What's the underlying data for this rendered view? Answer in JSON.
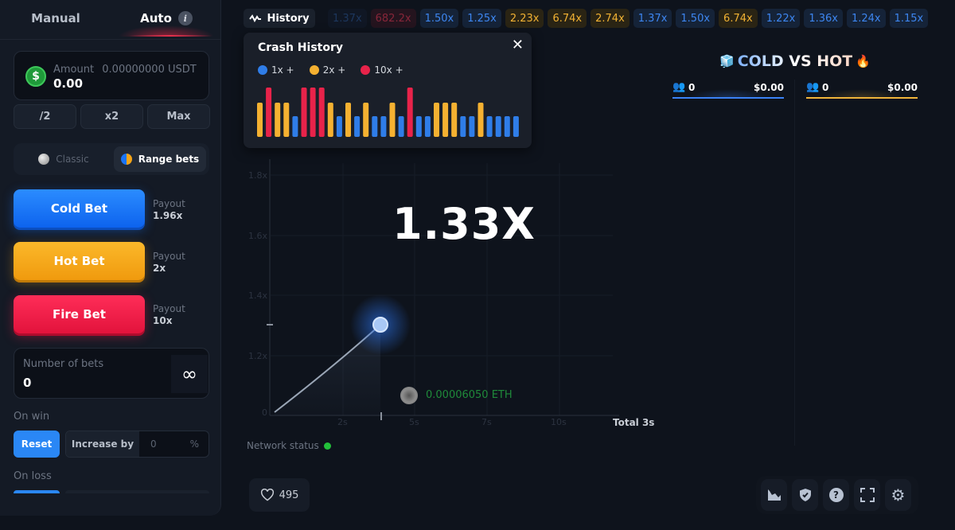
{
  "sidebar": {
    "tabs": [
      {
        "label": "Manual",
        "active": false
      },
      {
        "label": "Auto",
        "active": true
      }
    ],
    "info_icon": "info-icon",
    "amount": {
      "label": "Amount",
      "balance": "0.00000000 USDT",
      "value": "0.00",
      "icon": "dollar-coin-icon"
    },
    "amount_buttons": [
      "/2",
      "x2",
      "Max"
    ],
    "modes": [
      {
        "label": "Classic",
        "active": false
      },
      {
        "label": "Range bets",
        "active": true
      }
    ],
    "bets": [
      {
        "label": "Cold Bet",
        "payout_label": "Payout",
        "payout": "1.96x",
        "color": "#1a73f5"
      },
      {
        "label": "Hot Bet",
        "payout_label": "Payout",
        "payout": "2x",
        "color": "#f5a417"
      },
      {
        "label": "Fire Bet",
        "payout_label": "Payout",
        "payout": "10x",
        "color": "#ec1c45"
      }
    ],
    "number_of_bets": {
      "label": "Number of bets",
      "value": "0",
      "infinite_symbol": "∞"
    },
    "on_win": {
      "label": "On win",
      "reset": "Reset",
      "increase_by": "Increase by",
      "value": "0",
      "unit": "%"
    },
    "on_loss": {
      "label": "On loss"
    }
  },
  "history": {
    "button_label": "History",
    "chips": [
      {
        "value": "1.37x",
        "tier": "blue",
        "faded": true
      },
      {
        "value": "682.2x",
        "tier": "red",
        "faded": true
      },
      {
        "value": "1.50x",
        "tier": "blue"
      },
      {
        "value": "1.25x",
        "tier": "blue"
      },
      {
        "value": "2.23x",
        "tier": "yellow"
      },
      {
        "value": "6.74x",
        "tier": "yellow"
      },
      {
        "value": "2.74x",
        "tier": "yellow"
      },
      {
        "value": "1.37x",
        "tier": "blue"
      },
      {
        "value": "1.50x",
        "tier": "blue"
      },
      {
        "value": "6.74x",
        "tier": "yellow"
      },
      {
        "value": "1.22x",
        "tier": "blue"
      },
      {
        "value": "1.36x",
        "tier": "blue"
      },
      {
        "value": "1.24x",
        "tier": "blue"
      },
      {
        "value": "1.15x",
        "tier": "blue"
      }
    ]
  },
  "crash_history": {
    "title": "Crash History",
    "legend": [
      {
        "label": "1x +",
        "color": "#2f7de8"
      },
      {
        "label": "2x +",
        "color": "#f5b131"
      },
      {
        "label": "10x +",
        "color": "#e8234a"
      }
    ],
    "bars": [
      "2x",
      "10x",
      "2x",
      "2x",
      "1x",
      "10x",
      "10x",
      "10x",
      "2x",
      "1x",
      "2x",
      "1x",
      "2x",
      "1x",
      "1x",
      "2x",
      "1x",
      "10x",
      "1x",
      "1x",
      "2x",
      "2x",
      "2x",
      "1x",
      "1x",
      "2x",
      "1x",
      "1x",
      "1x",
      "1x"
    ]
  },
  "game": {
    "multiplier": "1.33X",
    "y_ticks": [
      "0",
      "1.2x",
      "1.4x",
      "1.6x",
      "1.8x"
    ],
    "x_ticks": [
      "2s",
      "5s",
      "7s",
      "10s"
    ],
    "total": "Total 3s",
    "player_bet": "0.00006050 ETH",
    "network_status": "Network status",
    "network_color": "#22c03a"
  },
  "versus": {
    "title": "COLD VS HOT",
    "cold": {
      "players": "0",
      "amount": "$0.00",
      "color": "#3b82f6"
    },
    "hot": {
      "players": "0",
      "amount": "$0.00",
      "color": "#f0b43a"
    }
  },
  "footer": {
    "likes": "495",
    "icons": [
      "chart-icon",
      "shield-check-icon",
      "help-icon",
      "fullscreen-icon",
      "settings-icon"
    ]
  }
}
